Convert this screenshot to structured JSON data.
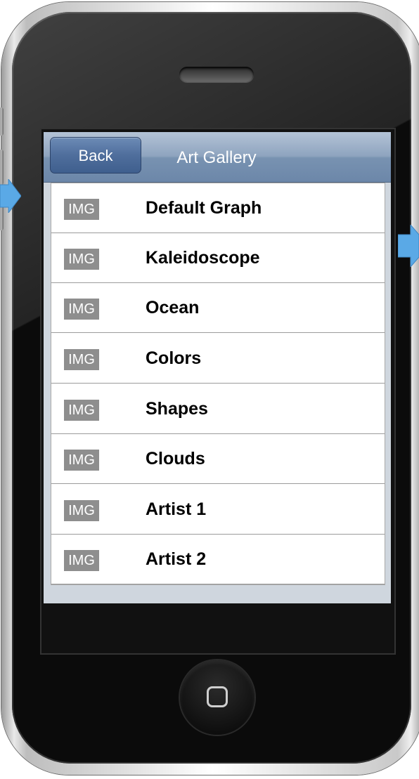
{
  "navbar": {
    "back_label": "Back",
    "title": "Art Gallery"
  },
  "list": {
    "placeholder_text": "IMG",
    "items": [
      {
        "label": "Default Graph"
      },
      {
        "label": "Kaleidoscope"
      },
      {
        "label": "Ocean"
      },
      {
        "label": "Colors"
      },
      {
        "label": "Shapes"
      },
      {
        "label": "Clouds"
      },
      {
        "label": "Artist 1"
      },
      {
        "label": "Artist 2"
      }
    ]
  },
  "colors": {
    "navbar": "#7892b1",
    "back_button": "#4f6e9c",
    "arrow": "#5aa9e6",
    "placeholder": "#8e8e8e"
  },
  "icons": {
    "left_arrow": "flow-arrow-icon",
    "right_arrow": "flow-arrow-icon",
    "home": "home-button-icon"
  }
}
